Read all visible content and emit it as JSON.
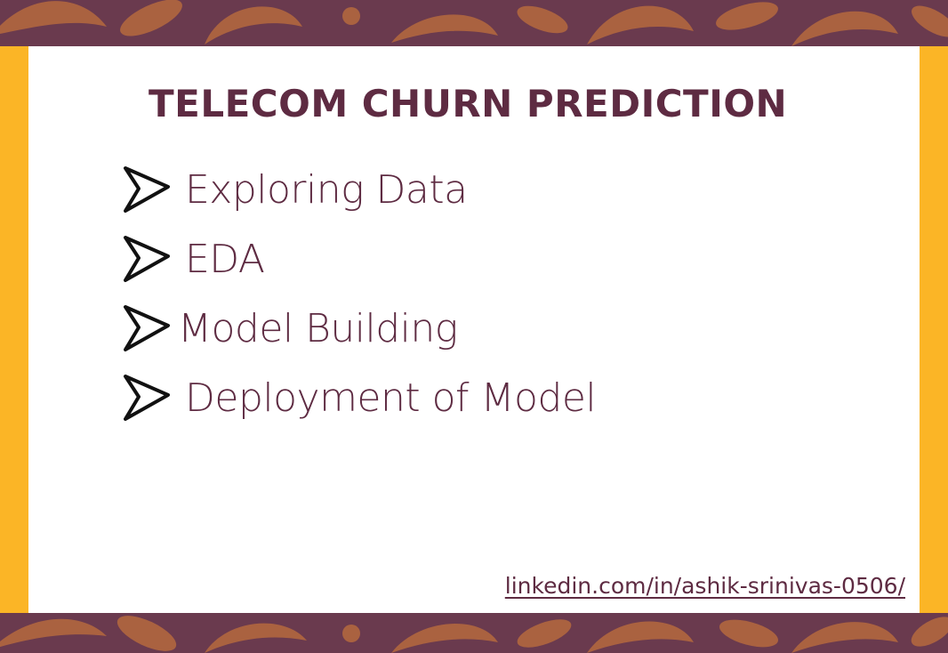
{
  "slide": {
    "title": "TELECOM CHURN PREDICTION",
    "items": [
      {
        "label": "Exploring Data",
        "icon": "arrow-right-icon"
      },
      {
        "label": "EDA",
        "icon": "arrow-right-icon"
      },
      {
        "label": "Model Building",
        "icon": "arrow-right-icon"
      },
      {
        "label": "Deployment of Model",
        "icon": "arrow-right-icon"
      }
    ],
    "link_text": "linkedin.com/in/ashik-srinivas-0506/"
  },
  "colors": {
    "background_plum": "#6a3a4e",
    "pattern_orange": "#b1673f",
    "frame_gold": "#fbb526",
    "card_white": "#ffffff",
    "text_plum": "#5e2b42",
    "arrow_black": "#111111"
  }
}
